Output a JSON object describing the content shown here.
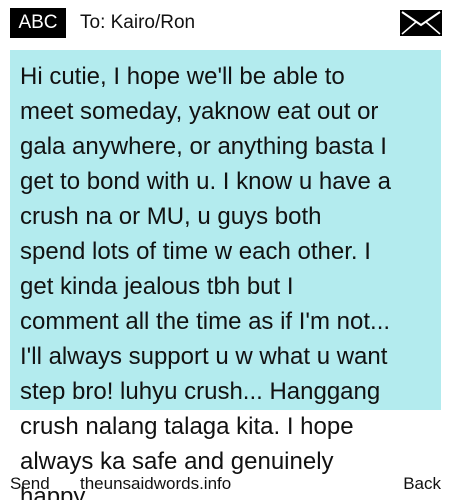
{
  "header": {
    "mode_label": "ABC",
    "recipient": "To: Kairo/Ron",
    "envelope_icon": "envelope-icon"
  },
  "message": {
    "text": "Hi cutie, I hope we'll be able to\nmeet someday, yaknow eat out or\ngala anywhere, or anything basta I\nget to bond with u. I know u have a\ncrush na or MU, u guys both\nspend lots of time w each other. I\nget kinda jealous tbh but I\ncomment all the time as if I'm not...\nI'll always support u w what u want\nstep bro! luhyu crush... Hanggang\ncrush nalang talaga kita. I hope\nalways ka safe and genuinely\nhappy",
    "highlight_color": "#b3ebee"
  },
  "softkeys": {
    "left": "Send",
    "center": "theunsaidwords.info",
    "right": "Back"
  }
}
